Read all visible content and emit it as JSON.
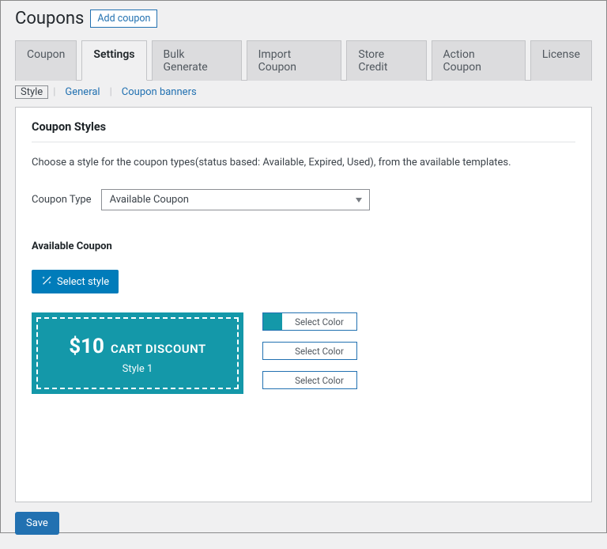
{
  "header": {
    "title": "Coupons",
    "add_button": "Add coupon"
  },
  "tabs": [
    "Coupon",
    "Settings",
    "Bulk Generate",
    "Import Coupon",
    "Store Credit",
    "Action Coupon",
    "License"
  ],
  "active_tab": "Settings",
  "subtabs": [
    "Style",
    "General",
    "Coupon banners"
  ],
  "active_subtab": "Style",
  "panel": {
    "heading": "Coupon Styles",
    "description": "Choose a style for the coupon types(status based: Available, Expired, Used), from the available templates.",
    "type_label": "Coupon Type",
    "type_value": "Available Coupon",
    "section_heading": "Available Coupon",
    "select_style_btn": "Select style",
    "coupon_preview": {
      "amount": "$10",
      "label": "CART DISCOUNT",
      "style_name": "Style 1"
    },
    "color_buttons": [
      "Select Color",
      "Select Color",
      "Select Color"
    ],
    "colors": [
      "#1498a9",
      "#ffffff",
      "#ffffff"
    ]
  },
  "footer": {
    "save": "Save"
  }
}
